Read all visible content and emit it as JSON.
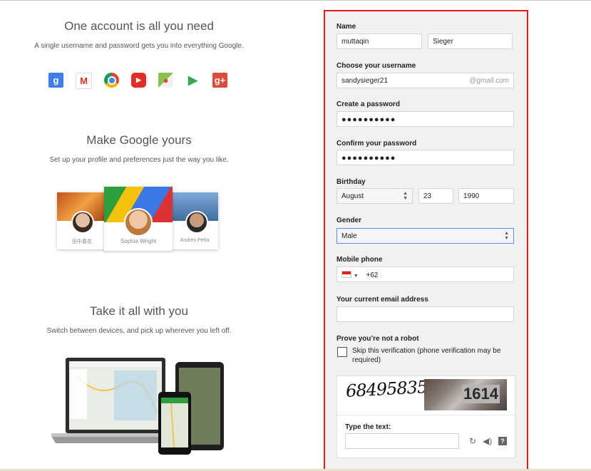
{
  "left": {
    "sections": [
      {
        "title": "One account is all you need",
        "subtitle": "A single username and password gets you into everything Google."
      },
      {
        "title": "Make Google yours",
        "subtitle": "Set up your profile and preferences just the way you like."
      },
      {
        "title": "Take it all with you",
        "subtitle": "Switch between devices, and pick up wherever you left off."
      }
    ],
    "product_icons": [
      "google-search-icon",
      "gmail-icon",
      "chrome-icon",
      "youtube-icon",
      "maps-icon",
      "play-store-icon",
      "google-plus-icon"
    ],
    "profiles": [
      {
        "name": "田中春花"
      },
      {
        "name": "Sophia Wright"
      },
      {
        "name": "Andrés Peña"
      }
    ]
  },
  "form": {
    "name_label": "Name",
    "first_name": "muttaqin",
    "last_name": "Sieger",
    "username_label": "Choose your username",
    "username": "sandysieger21",
    "username_suffix": "@gmail.com",
    "password_label": "Create a password",
    "password_mask": "●●●●●●●●●●",
    "confirm_label": "Confirm your password",
    "confirm_mask": "●●●●●●●●●●",
    "birthday_label": "Birthday",
    "birth_month": "August",
    "birth_day": "23",
    "birth_year": "1990",
    "gender_label": "Gender",
    "gender": "Male",
    "phone_label": "Mobile phone",
    "phone_code": "+62",
    "email_label": "Your current email address",
    "email_value": "",
    "robot_label": "Prove you’re not a robot",
    "skip_label": "Skip this verification (phone verification may be required)",
    "captcha_text": "68495835",
    "captcha_number": "1614",
    "type_text_label": "Type the text:"
  },
  "colors": {
    "highlight_border": "#e01b1b",
    "panel_bg": "#f1f1f1",
    "focus": "#4d90fe"
  }
}
